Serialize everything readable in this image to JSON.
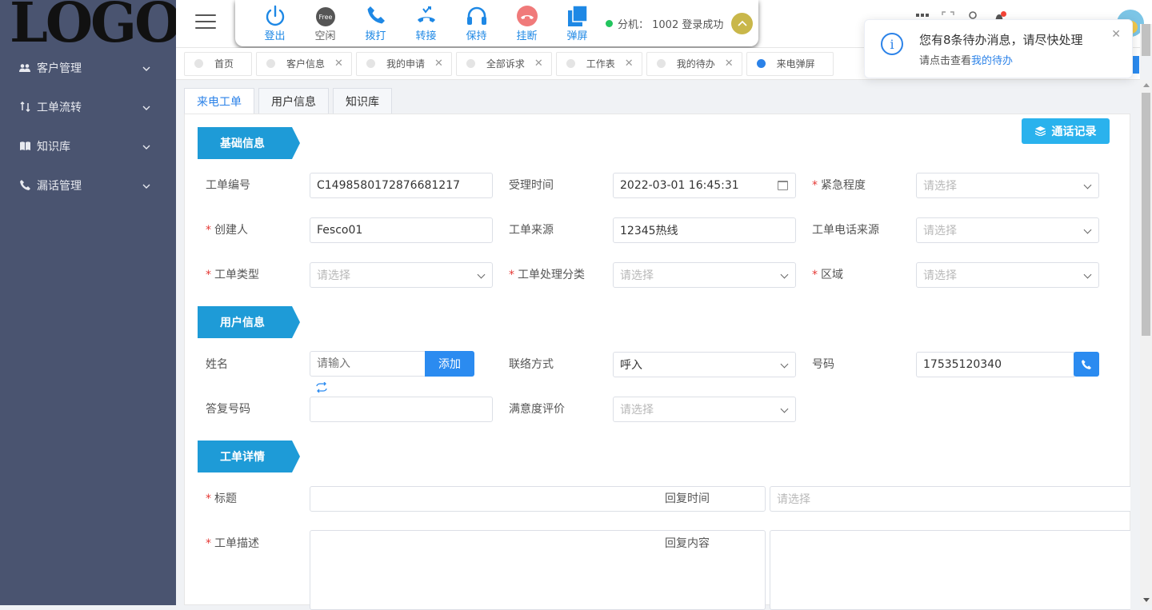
{
  "sidebar": {
    "logo": "LOGO",
    "items": [
      {
        "label": "客户管理",
        "icon": "users-icon"
      },
      {
        "label": "工单流转",
        "icon": "transfer-icon"
      },
      {
        "label": "知识库",
        "icon": "book-icon"
      },
      {
        "label": "漏话管理",
        "icon": "phone-icon"
      }
    ]
  },
  "phonebar": {
    "buttons": [
      {
        "label": "登出",
        "icon": "power-icon"
      },
      {
        "label": "空闲",
        "icon": "free-icon",
        "badge": "Free"
      },
      {
        "label": "拨打",
        "icon": "phone-dial-icon"
      },
      {
        "label": "转接",
        "icon": "transfer-call-icon"
      },
      {
        "label": "保持",
        "icon": "headset-icon"
      },
      {
        "label": "挂断",
        "icon": "hangup-icon"
      },
      {
        "label": "弹屏",
        "icon": "popup-icon"
      }
    ],
    "status": "分机： 1002 登录成功"
  },
  "tabs": [
    {
      "label": "首页",
      "closable": false,
      "active": false
    },
    {
      "label": "客户信息",
      "closable": true,
      "active": false
    },
    {
      "label": "我的申请",
      "closable": true,
      "active": false
    },
    {
      "label": "全部诉求",
      "closable": true,
      "active": false
    },
    {
      "label": "工作表",
      "closable": true,
      "active": false
    },
    {
      "label": "我的待办",
      "closable": true,
      "active": false
    },
    {
      "label": "来电弹屏",
      "closable": false,
      "active": true
    }
  ],
  "subtabs": [
    "来电工单",
    "用户信息",
    "知识库"
  ],
  "call_record_button": "通话记录",
  "sections": {
    "basic": "基础信息",
    "user": "用户信息",
    "detail": "工单详情"
  },
  "form": {
    "order_no_label": "工单编号",
    "order_no_value": "C1498580172876681217",
    "accept_time_label": "受理时间",
    "accept_time_value": "2022-03-01 16:45:31",
    "urgency_label": "紧急程度",
    "creator_label": "创建人",
    "creator_value": "Fesco01",
    "source_label": "工单来源",
    "source_value": "12345热线",
    "phone_source_label": "工单电话来源",
    "type_label": "工单类型",
    "category_label": "工单处理分类",
    "region_label": "区域",
    "name_label": "姓名",
    "name_placeholder": "请输入",
    "add_button": "添加",
    "contact_label": "联络方式",
    "contact_value": "呼入",
    "number_label": "号码",
    "number_value": "17535120340",
    "reply_number_label": "答复号码",
    "satisfaction_label": "满意度评价",
    "title_label": "标题",
    "reply_time_label": "回复时间",
    "desc_label": "工单描述",
    "reply_content_label": "回复内容",
    "select_placeholder": "请选择"
  },
  "notification": {
    "title": "您有8条待办消息，请尽快处理",
    "desc_prefix": "请点击查看",
    "desc_link": "我的待办"
  },
  "colors": {
    "sidebar": "#4a5470",
    "accent": "#1e88e5",
    "section": "#1e9bd7",
    "required": "#e53935"
  }
}
